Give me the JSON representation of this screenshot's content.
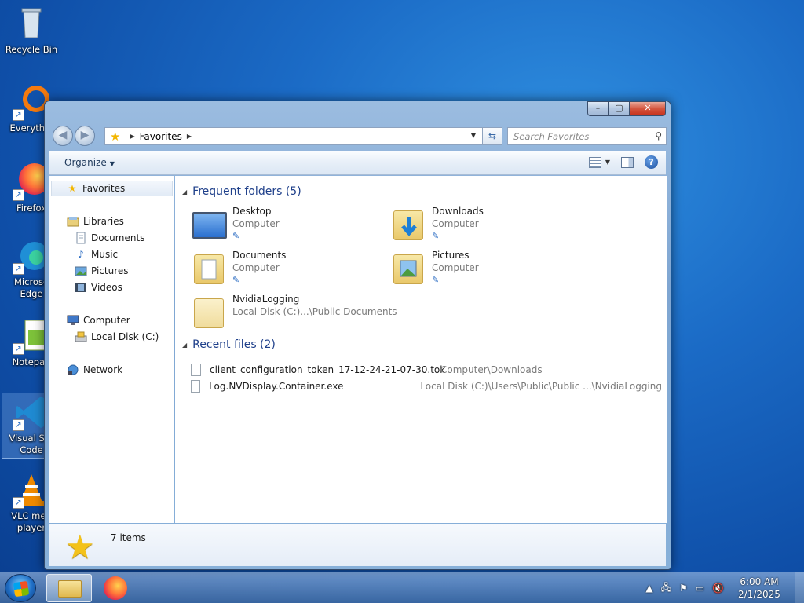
{
  "desktop": {
    "icons": [
      {
        "label": "Recycle Bin",
        "icon": "recycle-bin-icon"
      },
      {
        "label": "Everythin",
        "icon": "everything-icon"
      },
      {
        "label": "Firefox",
        "icon": "firefox-icon"
      },
      {
        "label": "Microso Edge",
        "icon": "edge-icon"
      },
      {
        "label": "Notepad",
        "icon": "notepad-icon"
      },
      {
        "label": "Visual Stu Code",
        "icon": "vscode-icon"
      },
      {
        "label": "VLC med player",
        "icon": "vlc-icon"
      }
    ]
  },
  "window": {
    "address": {
      "location": "Favorites"
    },
    "search": {
      "placeholder": "Search Favorites"
    },
    "toolbar": {
      "organize": "Organize"
    },
    "navpane": {
      "favorites": "Favorites",
      "libraries": "Libraries",
      "documents": "Documents",
      "music": "Music",
      "pictures": "Pictures",
      "videos": "Videos",
      "computer": "Computer",
      "local_disk": "Local Disk (C:)",
      "network": "Network"
    },
    "frequent": {
      "header": "Frequent folders (5)",
      "items": [
        {
          "name": "Desktop",
          "location": "Computer"
        },
        {
          "name": "Downloads",
          "location": "Computer"
        },
        {
          "name": "Documents",
          "location": "Computer"
        },
        {
          "name": "Pictures",
          "location": "Computer"
        },
        {
          "name": "NvidiaLogging",
          "location": "Local Disk (C:)...\\Public Documents"
        }
      ]
    },
    "recent": {
      "header": "Recent files (2)",
      "items": [
        {
          "name": "client_configuration_token_17-12-24-21-07-30.tok",
          "location": "Computer\\Downloads"
        },
        {
          "name": "Log.NVDisplay.Container.exe",
          "location": "Local Disk (C:)\\Users\\Public\\Public ...\\NvidiaLogging"
        }
      ]
    },
    "details": {
      "count": "7 items"
    }
  },
  "taskbar": {
    "time": "6:00 AM",
    "date": "2/1/2025"
  }
}
